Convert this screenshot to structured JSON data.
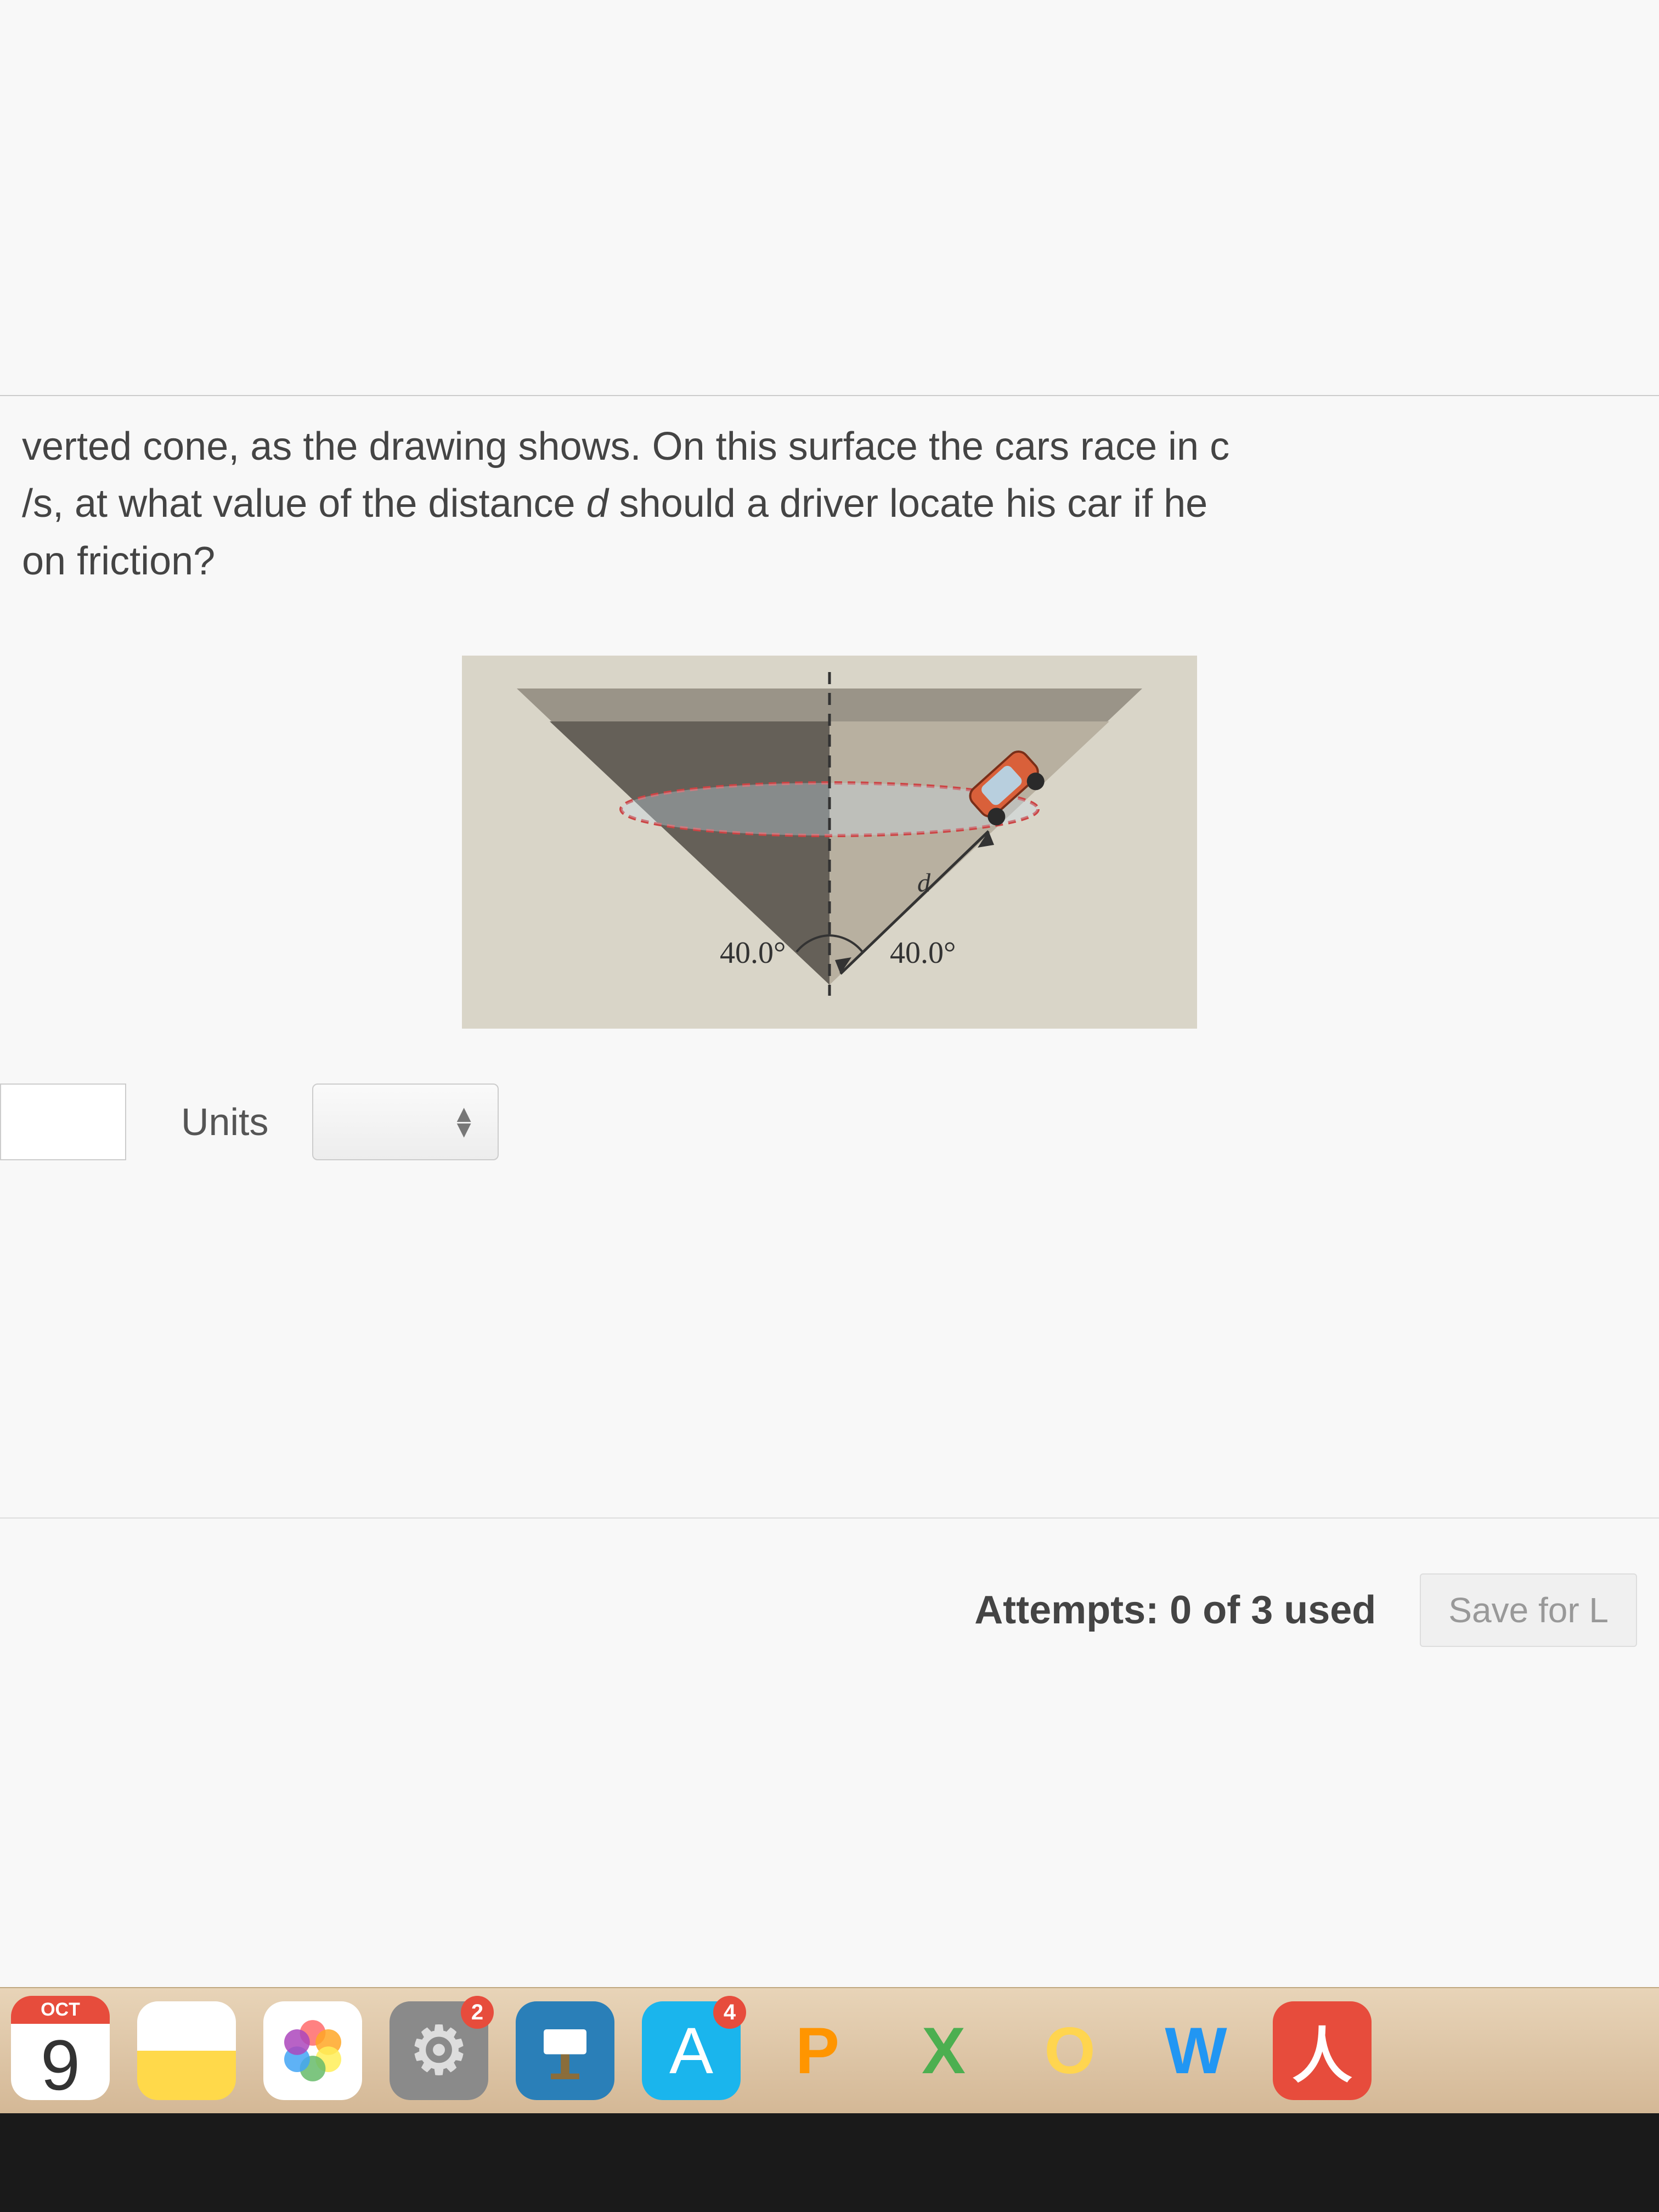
{
  "question": {
    "line1": "verted cone, as the drawing shows. On this surface the cars race in c",
    "line2_part1": "/s, at what value of the distance ",
    "line2_d": "d",
    "line2_part2": " should a driver locate his car if he ",
    "line3": "on friction?"
  },
  "diagram": {
    "angle_left": "40.0°",
    "angle_right": "40.0°",
    "distance_label": "d"
  },
  "input": {
    "units_label": "Units"
  },
  "footer": {
    "attempts": "Attempts: 0 of 3 used",
    "save_button": "Save for L"
  },
  "dock": {
    "calendar_month": "OCT",
    "calendar_day": "9",
    "settings_badge": "2",
    "appstore_badge": "4",
    "p_label": "P",
    "x_label": "X",
    "o_label": "O",
    "w_label": "W",
    "acrobat_label": "人"
  }
}
